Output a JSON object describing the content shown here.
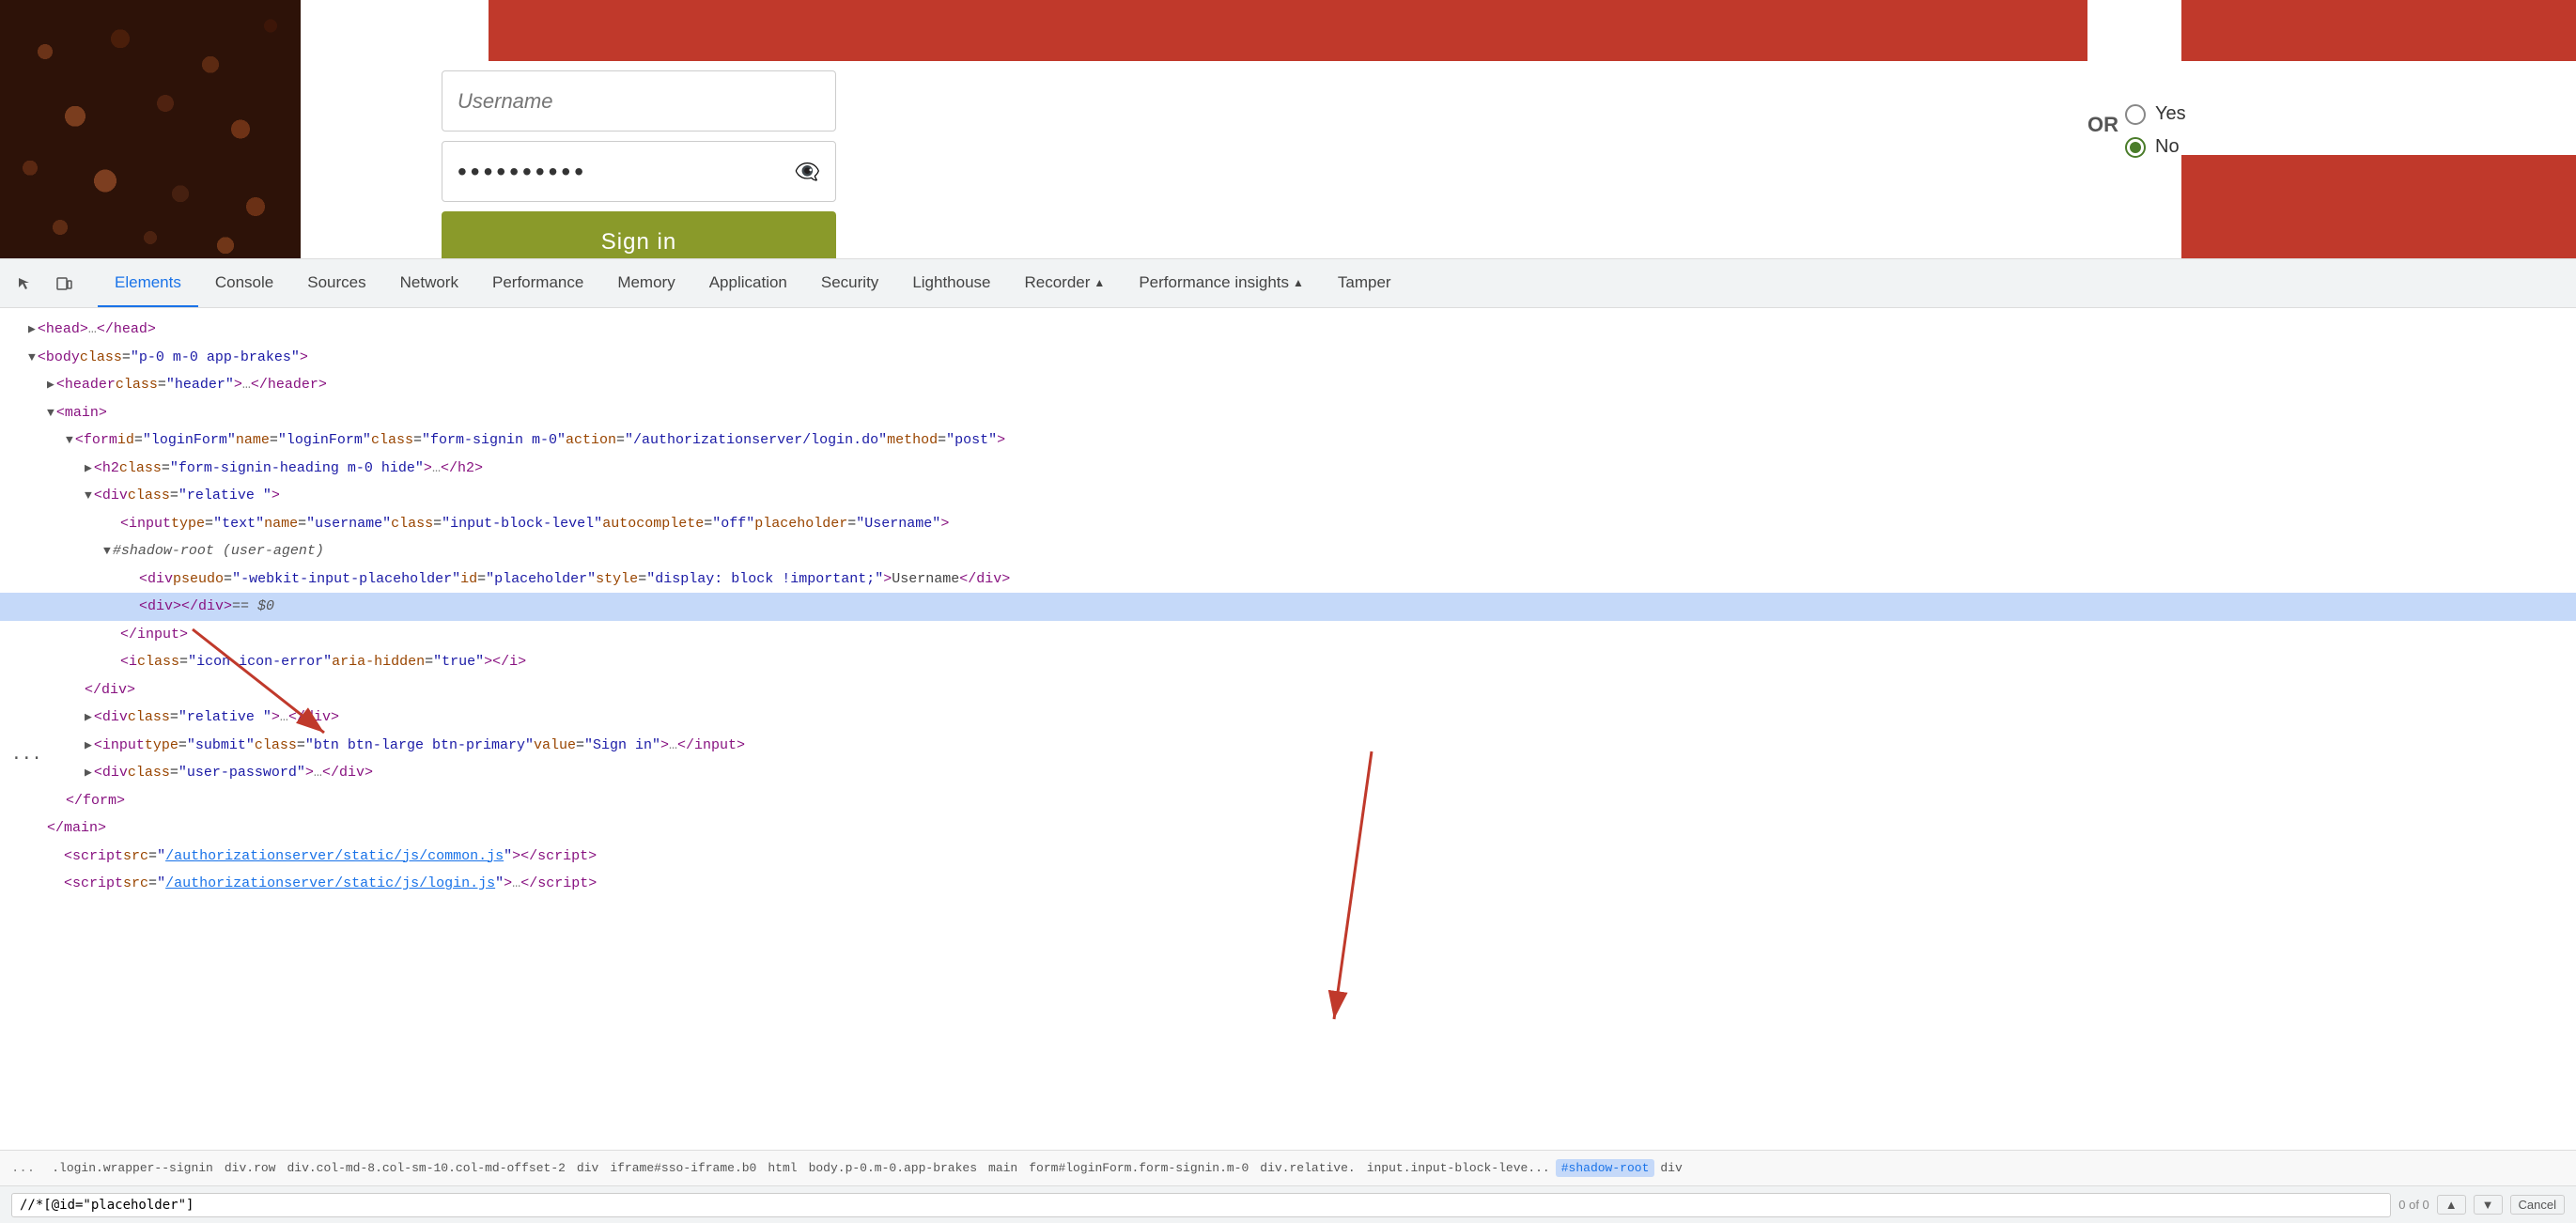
{
  "website": {
    "username_placeholder": "Username",
    "password_value": "••••••••••",
    "signin_label": "Sign in",
    "or_label": "OR",
    "yes_label": "Yes",
    "no_label": "No"
  },
  "devtools": {
    "tabs": [
      {
        "id": "elements",
        "label": "Elements",
        "active": true
      },
      {
        "id": "console",
        "label": "Console",
        "active": false
      },
      {
        "id": "sources",
        "label": "Sources",
        "active": false
      },
      {
        "id": "network",
        "label": "Network",
        "active": false
      },
      {
        "id": "performance",
        "label": "Performance",
        "active": false
      },
      {
        "id": "memory",
        "label": "Memory",
        "active": false
      },
      {
        "id": "application",
        "label": "Application",
        "active": false
      },
      {
        "id": "security",
        "label": "Security",
        "active": false
      },
      {
        "id": "lighthouse",
        "label": "Lighthouse",
        "active": false
      },
      {
        "id": "recorder",
        "label": "Recorder",
        "active": false,
        "has_icon": true
      },
      {
        "id": "performance-insights",
        "label": "Performance insights",
        "active": false,
        "has_icon": true
      },
      {
        "id": "tamper",
        "label": "Tamper",
        "active": false
      }
    ],
    "html_lines": [
      {
        "id": "head",
        "indent": 0,
        "content": "▶ <head>…</head>",
        "type": "collapsed"
      },
      {
        "id": "body",
        "indent": 0,
        "content": "▼ <body class=\"p-0 m-0 app-brakes\">",
        "type": "open"
      },
      {
        "id": "header",
        "indent": 1,
        "content": "▶ <header class=\"header\">…</header>",
        "type": "collapsed"
      },
      {
        "id": "main",
        "indent": 1,
        "content": "▼ <main>",
        "type": "open"
      },
      {
        "id": "form",
        "indent": 2,
        "content": "▼ <form id=\"loginForm\" name=\"loginForm\" class=\"form-signin m-0\" action=\"/authorizationserver/login.do\" method=\"post\">",
        "type": "open"
      },
      {
        "id": "h2",
        "indent": 3,
        "content": "▶ <h2 class=\"form-signin-heading m-0 hide\">…</h2>",
        "type": "collapsed"
      },
      {
        "id": "div-relative",
        "indent": 3,
        "content": "▼ <div class=\"relative \">",
        "type": "open"
      },
      {
        "id": "input-username",
        "indent": 4,
        "content": "<input type=\"text\" name=\"username\" class=\"input-block-level\" autocomplete=\"off\" placeholder=\"Username\">",
        "type": "leaf"
      },
      {
        "id": "shadow-root",
        "indent": 4,
        "content": "▼ #shadow-root (user-agent)",
        "type": "shadow"
      },
      {
        "id": "div-placeholder",
        "indent": 5,
        "content": "<div pseudo=\"-webkit-input-placeholder\" id=\"placeholder\" style=\"display: block !important;\">Username</div>",
        "type": "leaf"
      },
      {
        "id": "div-eq-s0",
        "indent": 5,
        "content": "<div></div> == $0",
        "type": "selected"
      },
      {
        "id": "close-input",
        "indent": 4,
        "content": "</input>",
        "type": "close"
      },
      {
        "id": "icon-error",
        "indent": 4,
        "content": "<i class=\"icon icon-error\" aria-hidden=\"true\"></i>",
        "type": "leaf"
      },
      {
        "id": "close-div1",
        "indent": 3,
        "content": "</div>",
        "type": "close"
      },
      {
        "id": "div-relative2",
        "indent": 3,
        "content": "▶ <div class=\"relative \">…</div>",
        "type": "collapsed"
      },
      {
        "id": "input-submit",
        "indent": 3,
        "content": "▶ <input type=\"submit\" class=\"btn btn-large btn-primary\" value=\"Sign in\">…</input>",
        "type": "collapsed"
      },
      {
        "id": "div-user-password",
        "indent": 3,
        "content": "▶ <div class=\"user-password\">…</div>",
        "type": "collapsed"
      },
      {
        "id": "close-form",
        "indent": 2,
        "content": "</form>",
        "type": "close"
      },
      {
        "id": "close-main",
        "indent": 1,
        "content": "</main>",
        "type": "close"
      },
      {
        "id": "script-common",
        "indent": 1,
        "content": "<script src=\"/authorizationserver/static/js/common.js\"></scr​ipt>",
        "type": "leaf",
        "has_link": true
      },
      {
        "id": "script-login",
        "indent": 1,
        "content": "<script src=\"/authorizationserver/static/js/login.js\">…</scr​ipt>",
        "type": "collapsed"
      }
    ],
    "breadcrumb": {
      "dots": "...",
      "items": [
        ".login.wrapper--signin",
        "div.row",
        "div.col-md-8.col-sm-10.col-md-offset-2",
        "div",
        "iframe#sso-iframe.b0",
        "html",
        "body.p-0.m-0.app-brakes",
        "main",
        "form#loginForm.form-signin.m-0",
        "div.relative.",
        "input.input-block-leve...",
        "#shadow-root",
        "div"
      ]
    },
    "search": {
      "value": "//*[@id=\"placeholder\"]",
      "count": "0 of 0",
      "cancel_label": "Cancel",
      "up_label": "▲",
      "down_label": "▼"
    }
  }
}
